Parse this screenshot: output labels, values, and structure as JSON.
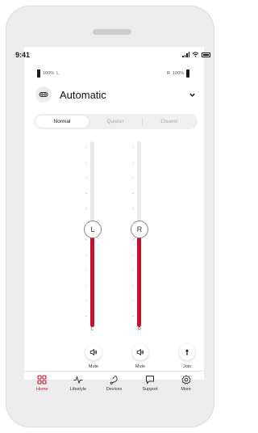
{
  "status_bar": {
    "time": "9:41"
  },
  "hearing_aids": {
    "left": {
      "battery": "100%",
      "side": "L"
    },
    "right": {
      "battery": "100%",
      "side": "R"
    }
  },
  "program": {
    "name": "Automatic",
    "icon": "automatic-program-icon"
  },
  "sound_modes": {
    "options": [
      "Normal",
      "Quieter",
      "Clearer"
    ],
    "selected": "Normal"
  },
  "volume": {
    "left": {
      "thumb_label": "L",
      "label": "L",
      "level": 0.52
    },
    "right": {
      "thumb_label": "R",
      "label": "R",
      "level": 0.52
    }
  },
  "controls": {
    "mute_left": "Mute",
    "mute_right": "Mute",
    "join": "Join"
  },
  "nav": {
    "items": [
      {
        "label": "Home",
        "icon": "home-grid-icon",
        "active": true
      },
      {
        "label": "Lifestyle",
        "icon": "activity-icon",
        "active": false
      },
      {
        "label": "Devices",
        "icon": "hearing-aid-icon",
        "active": false
      },
      {
        "label": "Support",
        "icon": "chat-bubble-icon",
        "active": false
      },
      {
        "label": "More",
        "icon": "gear-icon",
        "active": false
      }
    ]
  },
  "colors": {
    "accent": "#c8102e",
    "track": "#eaeaea",
    "frame": "#ececed"
  }
}
